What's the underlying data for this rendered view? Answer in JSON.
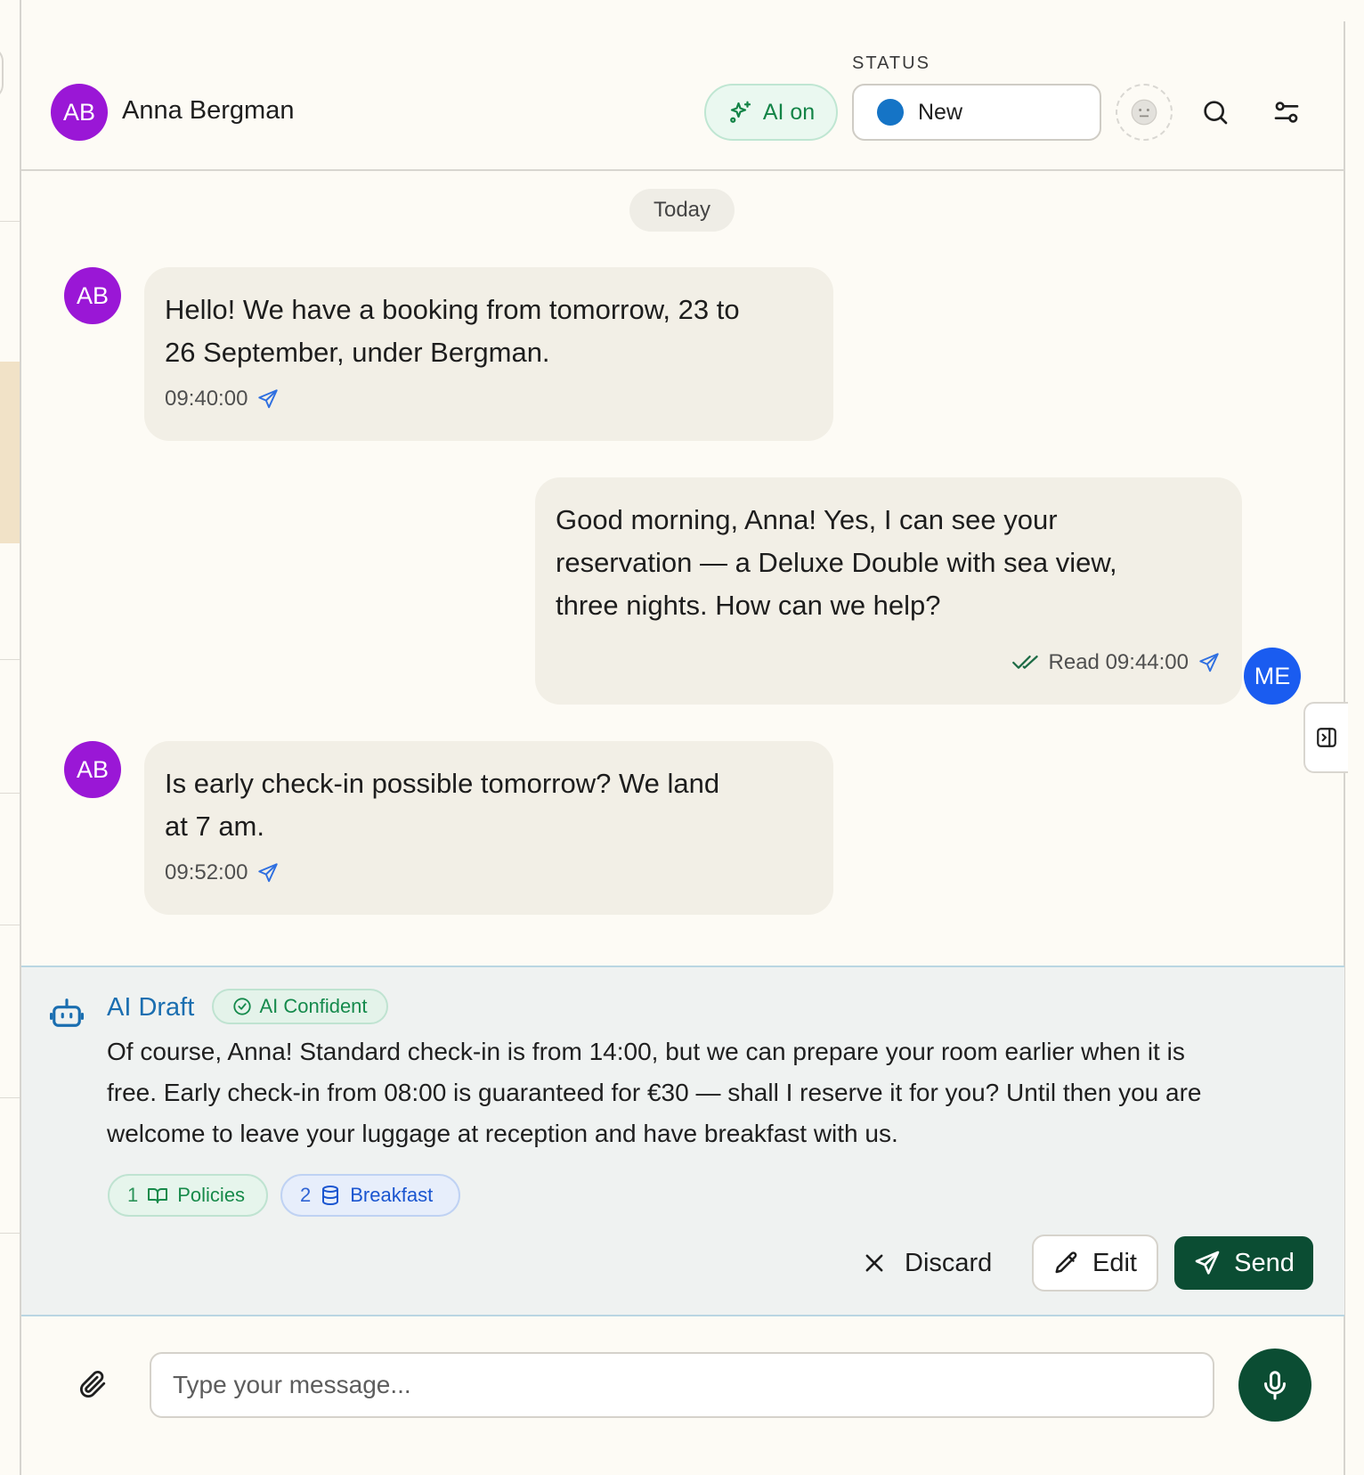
{
  "header": {
    "contact_initials": "AB",
    "contact_name": "Anna Bergman",
    "ai_toggle_label": "AI on",
    "status_label": "STATUS",
    "status_value": "New"
  },
  "conversation": {
    "date_divider": "Today",
    "messages": [
      {
        "sender": "contact",
        "initials": "AB",
        "text_lines": [
          "Hello! We have a booking from tomorrow, 23 to",
          "26 September, under Bergman."
        ],
        "time": "09:40:00"
      },
      {
        "sender": "agent",
        "initials": "ME",
        "text_lines": [
          "Good morning, Anna! Yes, I can see your",
          "reservation — a Deluxe Double with sea view,",
          "three nights. How can we help?"
        ],
        "status": "Read 09:44:00"
      },
      {
        "sender": "contact",
        "initials": "AB",
        "text_lines": [
          "Is early check-in possible tomorrow? We land",
          "at 7 am."
        ],
        "time": "09:52:00"
      }
    ]
  },
  "ai_draft": {
    "title": "AI Draft",
    "badge": "AI Confident",
    "text_lines": [
      "Of course, Anna! Standard check-in is from 14:00, but we can prepare your room earlier when it is",
      "free. Early check-in from 08:00 is guaranteed for €30 — shall I reserve it for you? Until then you are",
      "welcome to leave your luggage at reception and have breakfast with us."
    ],
    "sources": [
      {
        "number": "1",
        "label": "Policies",
        "icon": "book-icon"
      },
      {
        "number": "2",
        "label": "Breakfast",
        "icon": "database-icon"
      }
    ],
    "discard_label": "Discard",
    "edit_label": "Edit",
    "send_label": "Send"
  },
  "composer": {
    "placeholder": "Type your message..."
  },
  "colors": {
    "contact_avatar": "#9a17d6",
    "agent_avatar": "#1a5cf0",
    "brand_dark_green": "#0b4d33",
    "status_new": "#1574c6",
    "ai_green": "#138447",
    "draft_blue": "#1a6eb0"
  }
}
